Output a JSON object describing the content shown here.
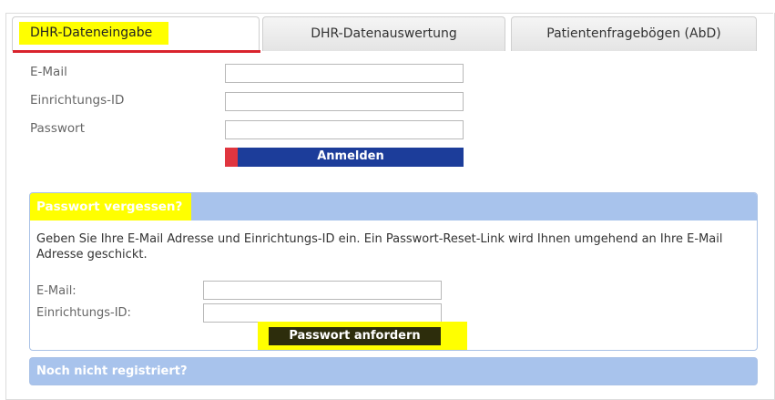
{
  "tabs": [
    {
      "label": "DHR-Dateneingabe",
      "active": true
    },
    {
      "label": "DHR-Datenauswertung",
      "active": false
    },
    {
      "label": "Patientenfragebögen (AbD)",
      "active": false
    }
  ],
  "login": {
    "email_label": "E-Mail",
    "email_value": "",
    "facility_label": "Einrichtungs-ID",
    "facility_value": "",
    "password_label": "Passwort",
    "password_value": "",
    "submit_label": "Anmelden"
  },
  "forgot": {
    "title": "Passwort vergessen?",
    "description": "Geben Sie Ihre E-Mail Adresse und Einrichtungs-ID ein. Ein Passwort-Reset-Link wird Ihnen umgehend an Ihre E-Mail Adresse geschickt.",
    "email_label": "E-Mail:",
    "email_value": "",
    "facility_label": "Einrichtungs-ID:",
    "facility_value": "",
    "submit_label": "Passwort anfordern"
  },
  "register": {
    "title": "Noch nicht registriert?"
  },
  "colors": {
    "highlight": "#ffff00",
    "primary_button": "#1c3d9a",
    "accent_red": "#e0353f",
    "panel_header": "#a8c3ec"
  }
}
